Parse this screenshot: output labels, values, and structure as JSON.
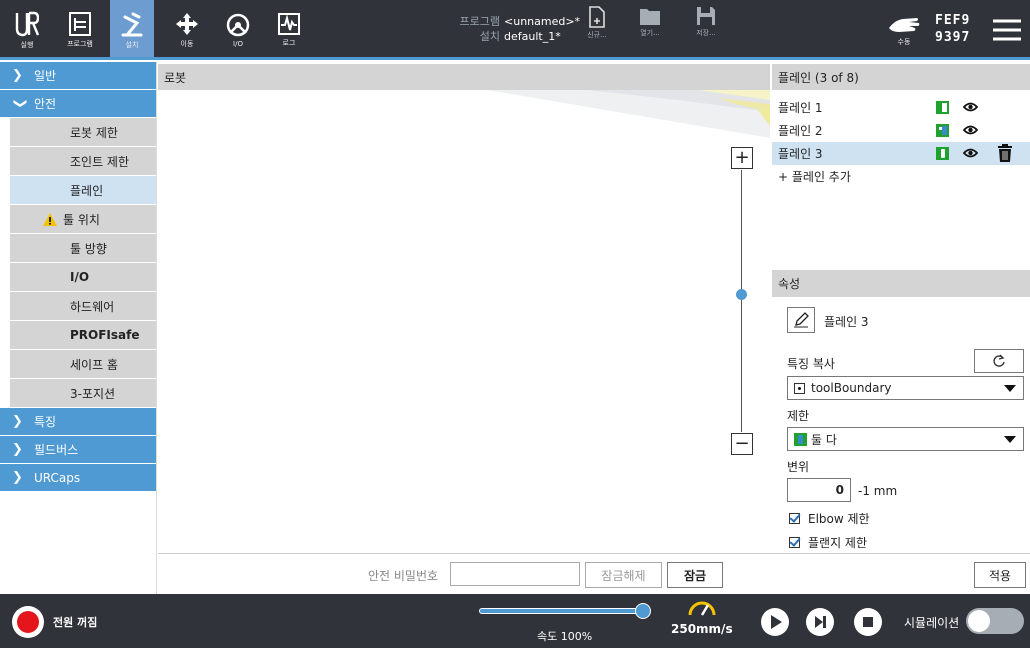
{
  "topbar": {
    "run_label": "실행",
    "program_label": "프로그램",
    "install_label": "설치",
    "move_label": "이동",
    "io_label": "I/O",
    "log_label": "로그",
    "program_key": "프로그램",
    "program_value": "<unnamed>*",
    "install_key": "설치",
    "install_value": "default_1*",
    "new_label": "신규...",
    "open_label": "열기...",
    "save_label": "저장...",
    "manual_label": "수동",
    "serial_top": "FEF9",
    "serial_bottom": "9397"
  },
  "nav": {
    "general": "일반",
    "safety": "안전",
    "robot_limits": "로봇 제한",
    "joint_limits": "조인트 제한",
    "planes": "플레인",
    "tool_position": "툴 위치",
    "tool_direction": "툴 방향",
    "io": "I/O",
    "hardware": "하드웨어",
    "profisafe": "PROFIsafe",
    "safe_home": "세이프 홈",
    "three_position": "3-포지션",
    "features": "특징",
    "fieldbus": "필드버스",
    "urcaps": "URCaps"
  },
  "view": {
    "title": "로봇"
  },
  "planes_panel": {
    "title": "플레인 (3 of 8)",
    "items": [
      {
        "label": "플레인 1"
      },
      {
        "label": "플레인 2"
      },
      {
        "label": "플레인 3"
      }
    ],
    "add_label": "+ 플레인 추가"
  },
  "properties": {
    "title": "속성",
    "name": "플레인 3",
    "copy_feature_label": "특징 복사",
    "copy_feature_value": "toolBoundary",
    "restriction_label": "제한",
    "restriction_value": "둘 다",
    "displacement_label": "변위",
    "displacement_value": "0",
    "displacement_unit": "-1 mm",
    "elbow_label": "Elbow 제한",
    "flange_label": "플랜지 제한"
  },
  "actions": {
    "password_label": "안전 비밀번호",
    "password_value": "",
    "unlock_label": "잠금해제",
    "lock_label": "잠금",
    "apply_label": "적용"
  },
  "footer": {
    "power_label": "전원 꺼짐",
    "speed_label": "속도 100%",
    "speed_percent": 100,
    "tcp_speed": "250mm/s",
    "simulation_label": "시뮬레이션"
  },
  "colors": {
    "accent": "#4f9ad3",
    "topbar_bg": "#30343a",
    "selected_bg": "#cfe2f2",
    "header_gray": "#d4d4d4",
    "green": "#1fa22e",
    "power_red": "#e5161b"
  }
}
